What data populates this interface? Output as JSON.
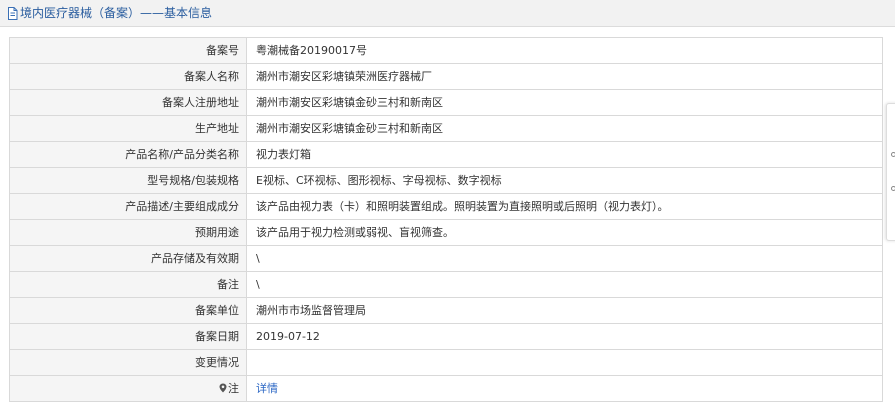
{
  "header": {
    "title": "境内医疗器械（备案）——基本信息",
    "icon": "document-icon"
  },
  "rows": [
    {
      "label": "备案号",
      "value": "粤潮械备20190017号"
    },
    {
      "label": "备案人名称",
      "value": "潮州市潮安区彩塘镇荣洲医疗器械厂"
    },
    {
      "label": "备案人注册地址",
      "value": "潮州市潮安区彩塘镇金砂三村和新南区"
    },
    {
      "label": "生产地址",
      "value": "潮州市潮安区彩塘镇金砂三村和新南区"
    },
    {
      "label": "产品名称/产品分类名称",
      "value": "视力表灯箱"
    },
    {
      "label": "型号规格/包装规格",
      "value": "E视标、C环视标、图形视标、字母视标、数字视标"
    },
    {
      "label": "产品描述/主要组成成分",
      "value": "该产品由视力表（卡）和照明装置组成。照明装置为直接照明或后照明（视力表灯）。"
    },
    {
      "label": "预期用途",
      "value": "该产品用于视力检测或弱视、盲视筛查。"
    },
    {
      "label": "产品存储及有效期",
      "value": "\\"
    },
    {
      "label": "备注",
      "value": "\\"
    },
    {
      "label": "备案单位",
      "value": "潮州市市场监督管理局"
    },
    {
      "label": "备案日期",
      "value": "2019-07-12"
    },
    {
      "label": "变更情况",
      "value": ""
    }
  ],
  "note_row": {
    "label": "注",
    "link_text": "详情",
    "icon": "pin-icon"
  },
  "colors": {
    "title": "#2a5d9f",
    "link": "#2a66c4",
    "label_bg": "#f5f5f5",
    "border": "#d9d9d9"
  }
}
